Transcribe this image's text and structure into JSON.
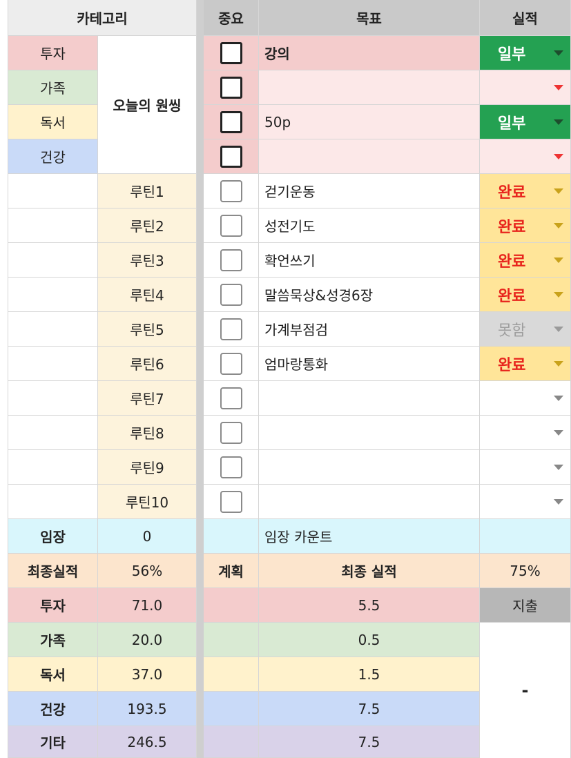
{
  "header": {
    "category": "카테고리",
    "important": "중요",
    "goal": "목표",
    "result": "실적"
  },
  "categories": [
    {
      "label": "투자",
      "color": "#f4cccc"
    },
    {
      "label": "가족",
      "color": "#d9ead3"
    },
    {
      "label": "독서",
      "color": "#fff2cc"
    },
    {
      "label": "건강",
      "color": "#c9daf8"
    }
  ],
  "merged_label": "오늘의 원씽",
  "top_goals": [
    {
      "goal": "강의",
      "status": "일부"
    },
    {
      "goal": "",
      "status": ""
    },
    {
      "goal": "50p",
      "status": "일부"
    },
    {
      "goal": "",
      "status": ""
    }
  ],
  "routines": [
    {
      "label": "루틴1",
      "goal": "걷기운동",
      "status": "완료"
    },
    {
      "label": "루틴2",
      "goal": "성전기도",
      "status": "완료"
    },
    {
      "label": "루틴3",
      "goal": "확언쓰기",
      "status": "완료"
    },
    {
      "label": "루틴4",
      "goal": "말씀묵상&성경6장",
      "status": "완료"
    },
    {
      "label": "루틴5",
      "goal": "가계부점검",
      "status": "못함"
    },
    {
      "label": "루틴6",
      "goal": "엄마랑통화",
      "status": "완료"
    },
    {
      "label": "루틴7",
      "goal": "",
      "status": ""
    },
    {
      "label": "루틴8",
      "goal": "",
      "status": ""
    },
    {
      "label": "루틴9",
      "goal": "",
      "status": ""
    },
    {
      "label": "루틴10",
      "goal": "",
      "status": ""
    }
  ],
  "imjang": {
    "label": "임장",
    "value": "0",
    "count_label": "임장 카운트"
  },
  "final": {
    "label": "최종실적",
    "value": "56%",
    "plan": "계획",
    "final_result": "최종 실적",
    "value2": "75%",
    "expense": "지출",
    "dash": "-"
  },
  "summary": [
    {
      "label": "투자",
      "value": "71.0",
      "final": "5.5",
      "color": "#f4cccc"
    },
    {
      "label": "가족",
      "value": "20.0",
      "final": "0.5",
      "color": "#d9ead3"
    },
    {
      "label": "독서",
      "value": "37.0",
      "final": "1.5",
      "color": "#fff2cc"
    },
    {
      "label": "건강",
      "value": "193.5",
      "final": "7.5",
      "color": "#c9daf8"
    },
    {
      "label": "기타",
      "value": "246.5",
      "final": "7.5",
      "color": "#d9d2e9"
    }
  ],
  "colors": {
    "status_done_text": "#e8241c",
    "status_done_bg": "#ffe599",
    "status_partial_bg": "#24a152",
    "status_partial_text": "#ffffff",
    "status_missed_bg": "#d9d9d9",
    "status_missed_text": "#9e9e9e",
    "arrow_red": "#ee3333",
    "arrow_dark": "#1d4d2d",
    "arrow_gold": "#c9a21b"
  }
}
